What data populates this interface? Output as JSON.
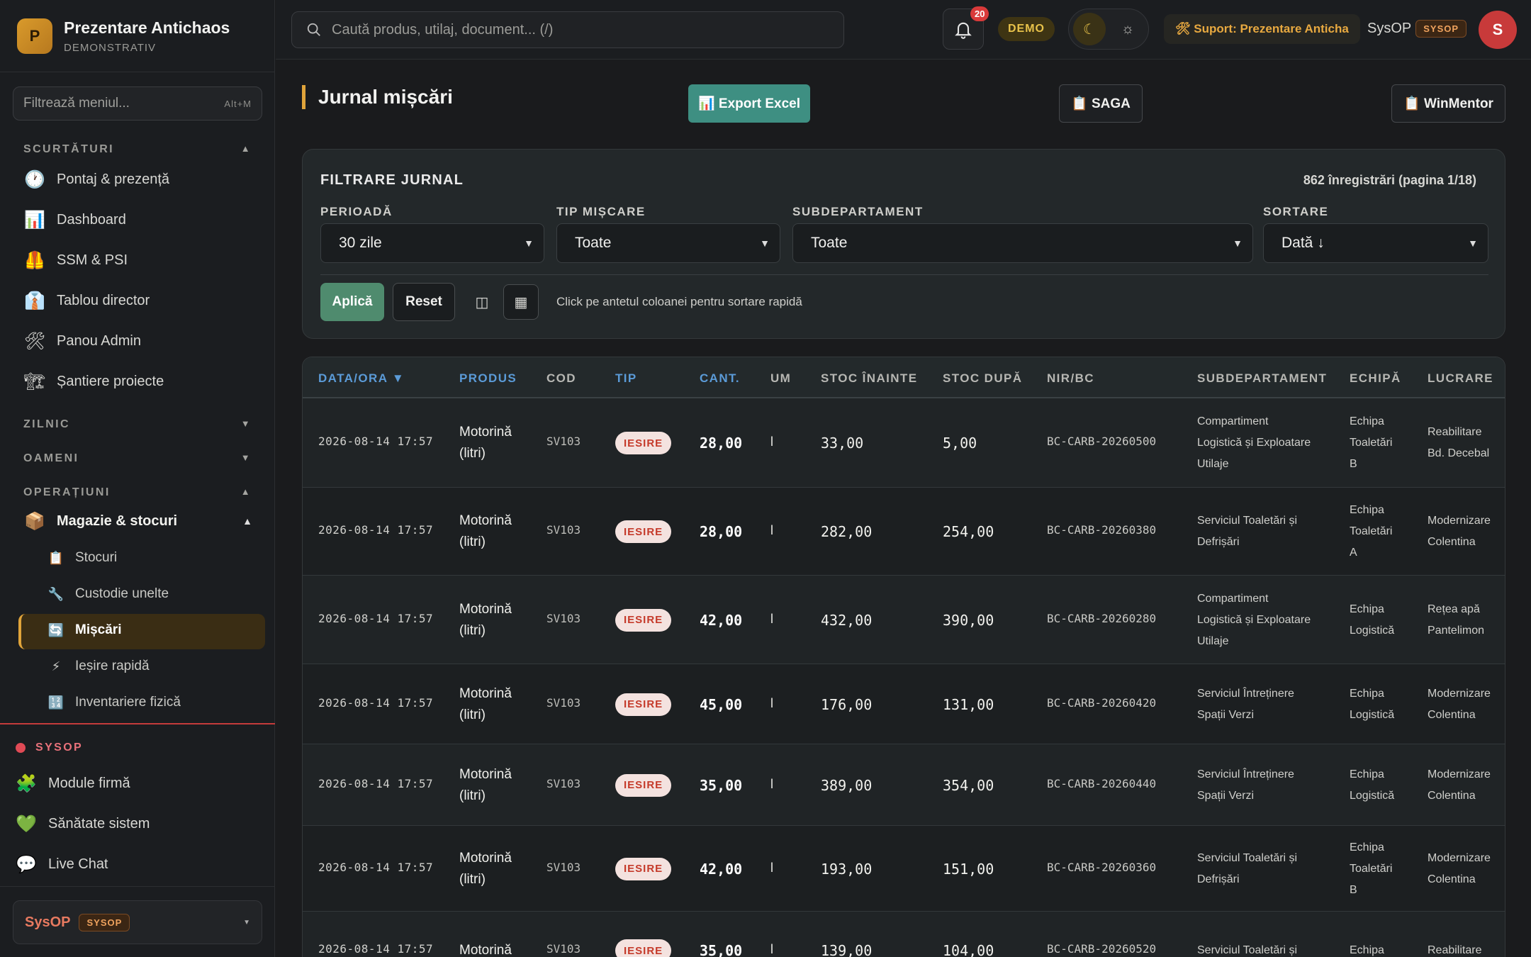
{
  "brand": {
    "logo_letter": "P",
    "name": "Prezentare Antichaos",
    "subtitle": "DEMONSTRATIV"
  },
  "menu_filter": {
    "placeholder": "Filtrează meniul...",
    "shortcut": "Alt+M"
  },
  "sidebar": {
    "shortcuts_title": "SCURTĂTURI",
    "shortcuts": [
      {
        "label": "Pontaj & prezență",
        "icon": "clock-icon"
      },
      {
        "label": "Dashboard",
        "icon": "bar-chart-icon"
      },
      {
        "label": "SSM & PSI",
        "icon": "safety-vest-icon"
      },
      {
        "label": "Tablou director",
        "icon": "suit-icon"
      },
      {
        "label": "Panou Admin",
        "icon": "tools-icon"
      },
      {
        "label": "Șantiere proiecte",
        "icon": "construction-icon"
      }
    ],
    "daily_title": "ZILNIC",
    "people_title": "OAMENI",
    "operations_title": "OPERAȚIUNI",
    "warehouse": {
      "label": "Magazie & stocuri",
      "icon": "package-icon"
    },
    "warehouse_items": [
      {
        "label": "Stocuri",
        "icon": "clipboard-icon"
      },
      {
        "label": "Custodie unelte",
        "icon": "wrench-icon"
      },
      {
        "label": "Mișcări",
        "icon": "refresh-icon"
      },
      {
        "label": "Ieșire rapidă",
        "icon": "lightning-icon"
      },
      {
        "label": "Inventariere fizică",
        "icon": "numbers-icon"
      }
    ],
    "sysop_title": "SYSOP",
    "sysop_items": [
      {
        "label": "Module firmă",
        "icon": "puzzle-icon"
      },
      {
        "label": "Sănătate sistem",
        "icon": "heart-icon"
      },
      {
        "label": "Live Chat",
        "icon": "chat-bubble-icon"
      }
    ],
    "footer_user": {
      "name": "SysOP",
      "role": "SYSOP"
    }
  },
  "topbar": {
    "search_placeholder": "Caută produs, utilaj, document... (/)",
    "notifications_count": "20",
    "demo_label": "DEMO",
    "support_label": "🛠 Suport: Prezentare Anticha",
    "user_name": "SysOP",
    "user_role": "SYSOP",
    "avatar_letter": "S"
  },
  "page": {
    "title": "Jurnal mișcări",
    "export_label": "📊 Export Excel",
    "saga_label": "📋 SAGA",
    "winmentor_label": "📋 WinMentor"
  },
  "filters": {
    "title": "FILTRARE JURNAL",
    "count_text": "862 înregistrări (pagina 1/18)",
    "period_label": "PERIOADĂ",
    "period_value": "30 zile",
    "type_label": "TIP MIȘCARE",
    "type_value": "Toate",
    "subdept_label": "SUBDEPARTAMENT",
    "subdept_value": "Toate",
    "sort_label": "SORTARE",
    "sort_value": "Dată ↓",
    "apply_label": "Aplică",
    "reset_label": "Reset",
    "hint": "Click pe antetul coloanei pentru sortare rapidă"
  },
  "table": {
    "columns": [
      "DATA/ORA ▼",
      "PRODUS",
      "COD",
      "TIP",
      "CANT.",
      "UM",
      "STOC ÎNAINTE",
      "STOC DUPĂ",
      "NIR/BC",
      "SUBDEPARTAMENT",
      "ECHIPĂ",
      "LUCRARE"
    ],
    "rows": [
      {
        "date": "2026-08-14 17:57",
        "product": [
          "Motorină",
          "(litri)"
        ],
        "code": "SV103",
        "type": "IESIRE",
        "qty": "28,00",
        "um": "l",
        "before": "33,00",
        "after": "5,00",
        "nir": "BC-CARB-20260500",
        "subdept": [
          "Compartiment",
          "Logistică și Exploatare",
          "Utilaje"
        ],
        "team": [
          "Echipa",
          "Toaletări",
          "B"
        ],
        "work": [
          "Reabilitare",
          "Bd. Decebal"
        ]
      },
      {
        "date": "2026-08-14 17:57",
        "product": [
          "Motorină",
          "(litri)"
        ],
        "code": "SV103",
        "type": "IESIRE",
        "qty": "28,00",
        "um": "l",
        "before": "282,00",
        "after": "254,00",
        "nir": "BC-CARB-20260380",
        "subdept": [
          "Serviciul Toaletări și",
          "Defrișări"
        ],
        "team": [
          "Echipa",
          "Toaletări",
          "A"
        ],
        "work": [
          "Modernizare",
          "Colentina"
        ]
      },
      {
        "date": "2026-08-14 17:57",
        "product": [
          "Motorină",
          "(litri)"
        ],
        "code": "SV103",
        "type": "IESIRE",
        "qty": "42,00",
        "um": "l",
        "before": "432,00",
        "after": "390,00",
        "nir": "BC-CARB-20260280",
        "subdept": [
          "Compartiment",
          "Logistică și Exploatare",
          "Utilaje"
        ],
        "team": [
          "Echipa",
          "Logistică"
        ],
        "work": [
          "Rețea apă",
          "Pantelimon"
        ]
      },
      {
        "date": "2026-08-14 17:57",
        "product": [
          "Motorină",
          "(litri)"
        ],
        "code": "SV103",
        "type": "IESIRE",
        "qty": "45,00",
        "um": "l",
        "before": "176,00",
        "after": "131,00",
        "nir": "BC-CARB-20260420",
        "subdept": [
          "Serviciul Întreținere",
          "Spații Verzi"
        ],
        "team": [
          "Echipa",
          "Logistică"
        ],
        "work": [
          "Modernizare",
          "Colentina"
        ]
      },
      {
        "date": "2026-08-14 17:57",
        "product": [
          "Motorină",
          "(litri)"
        ],
        "code": "SV103",
        "type": "IESIRE",
        "qty": "35,00",
        "um": "l",
        "before": "389,00",
        "after": "354,00",
        "nir": "BC-CARB-20260440",
        "subdept": [
          "Serviciul Întreținere",
          "Spații Verzi"
        ],
        "team": [
          "Echipa",
          "Logistică"
        ],
        "work": [
          "Modernizare",
          "Colentina"
        ]
      },
      {
        "date": "2026-08-14 17:57",
        "product": [
          "Motorină",
          "(litri)"
        ],
        "code": "SV103",
        "type": "IESIRE",
        "qty": "42,00",
        "um": "l",
        "before": "193,00",
        "after": "151,00",
        "nir": "BC-CARB-20260360",
        "subdept": [
          "Serviciul Toaletări și",
          "Defrișări"
        ],
        "team": [
          "Echipa",
          "Toaletări",
          "B"
        ],
        "work": [
          "Modernizare",
          "Colentina"
        ]
      },
      {
        "date": "2026-08-14 17:57",
        "product": [
          "Motorină"
        ],
        "code": "SV103",
        "type": "IESIRE",
        "qty": "35,00",
        "um": "l",
        "before": "139,00",
        "after": "104,00",
        "nir": "BC-CARB-20260520",
        "subdept": [
          "Serviciul Toaletări și"
        ],
        "team": [
          "Echipa"
        ],
        "work": [
          "Reabilitare"
        ]
      }
    ]
  }
}
